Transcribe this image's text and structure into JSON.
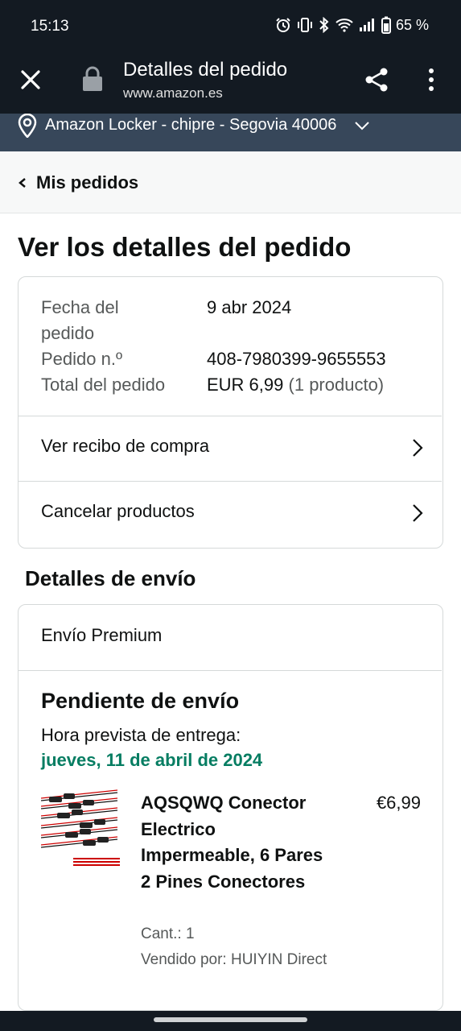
{
  "status_bar": {
    "time": "15:13",
    "battery": "65 %"
  },
  "browser": {
    "title": "Detalles del pedido",
    "url": "www.amazon.es"
  },
  "location": {
    "text": "Amazon Locker - chipre - Segovia 40006"
  },
  "breadcrumb": {
    "label": "Mis pedidos"
  },
  "page": {
    "title": "Ver los detalles del pedido"
  },
  "order": {
    "date_label_1": "Fecha del",
    "date_label_2": "pedido",
    "date_value": "9 abr 2024",
    "number_label": "Pedido n.º",
    "number_value": "408-7980399-9655553",
    "total_label": "Total del pedido",
    "total_value": "EUR 6,99",
    "total_count": "(1 producto)",
    "links": [
      {
        "label": "Ver recibo de compra"
      },
      {
        "label": "Cancelar productos"
      }
    ]
  },
  "shipping": {
    "section_title": "Detalles de envío",
    "type": "Envío Premium",
    "status": "Pendiente de envío",
    "eta_label": "Hora prevista de entrega:",
    "eta_date": "jueves, 11 de abril de 2024",
    "eta_color": "#067d62",
    "product": {
      "title": "AQSQWQ Conector Electrico Impermeable, 6 Pares 2 Pines Conectores",
      "price": "€6,99",
      "quantity": "Cant.: 1",
      "seller": "Vendido por: HUIYIN Direct"
    }
  },
  "colors": {
    "header_bg": "#131a22",
    "location_bg": "#37475a",
    "crumb_bg": "#f7f8f8"
  }
}
